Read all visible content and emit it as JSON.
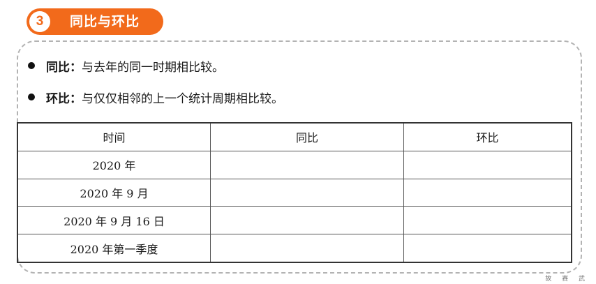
{
  "section": {
    "number": "3",
    "title": "同比与环比"
  },
  "bullets": [
    {
      "term": "同比",
      "colon": "：",
      "text": "与去年的同一时期相比较。"
    },
    {
      "term": "环比",
      "colon": "：",
      "text": "与仅仅相邻的上一个统计周期相比较。"
    }
  ],
  "table": {
    "headers": [
      "时间",
      "同比",
      "环比"
    ],
    "rows": [
      [
        "2020 年",
        "",
        ""
      ],
      [
        "2020 年 9 月",
        "",
        ""
      ],
      [
        "2020 年 9 月 16 日",
        "",
        ""
      ],
      [
        "2020 年第一季度",
        "",
        ""
      ]
    ]
  },
  "footer": "故 赛 武",
  "colors": {
    "accent": "#f26a1b",
    "border": "#b3b3b3"
  }
}
